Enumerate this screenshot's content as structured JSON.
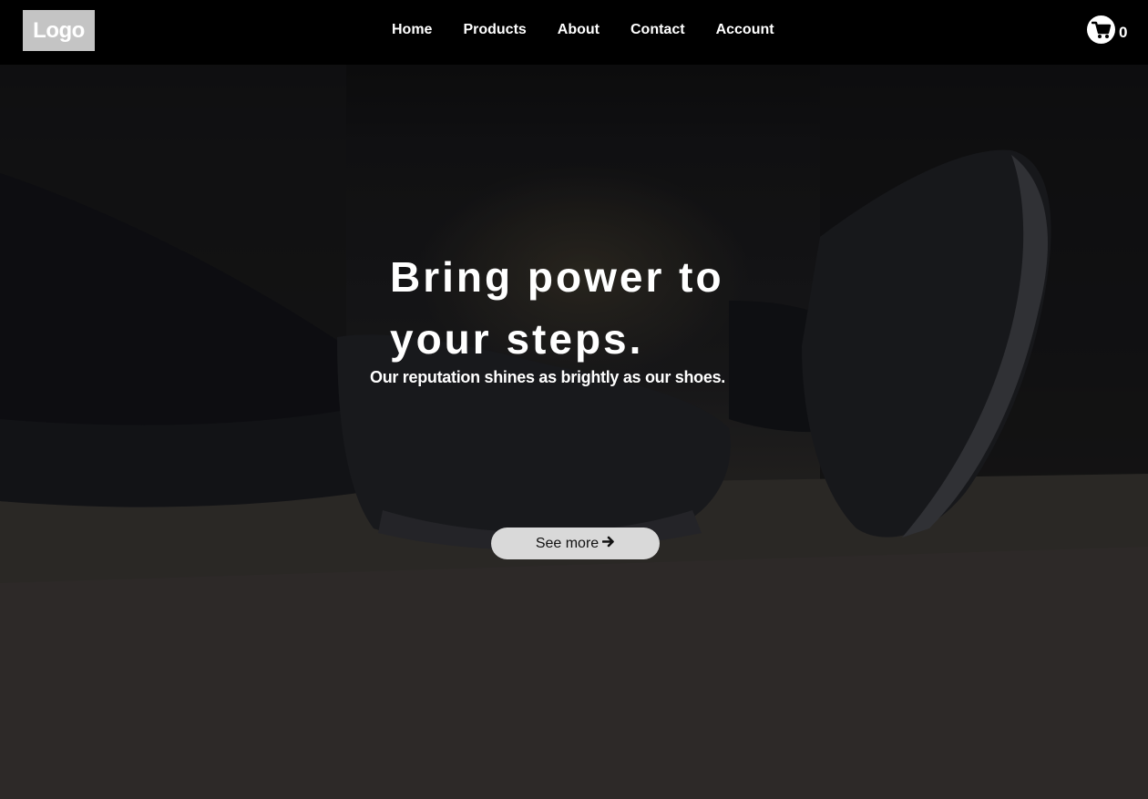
{
  "navbar": {
    "logo_text": "Logo",
    "links": [
      {
        "label": "Home"
      },
      {
        "label": "Products"
      },
      {
        "label": "About"
      },
      {
        "label": "Contact"
      },
      {
        "label": "Account"
      }
    ],
    "cart": {
      "icon": "shopping-cart-icon",
      "count": "0"
    }
  },
  "hero": {
    "title": "Bring power to your steps.",
    "subtitle": "Our reputation shines as brightly as our shoes.",
    "cta_label": "See more",
    "cta_icon": "arrow-right-icon",
    "background_image": "sneakers-photo"
  },
  "colors": {
    "navbar_bg": "#000000",
    "logo_bg": "#c4c4c4",
    "button_bg": "#d9d9d9",
    "text": "#ffffff"
  }
}
